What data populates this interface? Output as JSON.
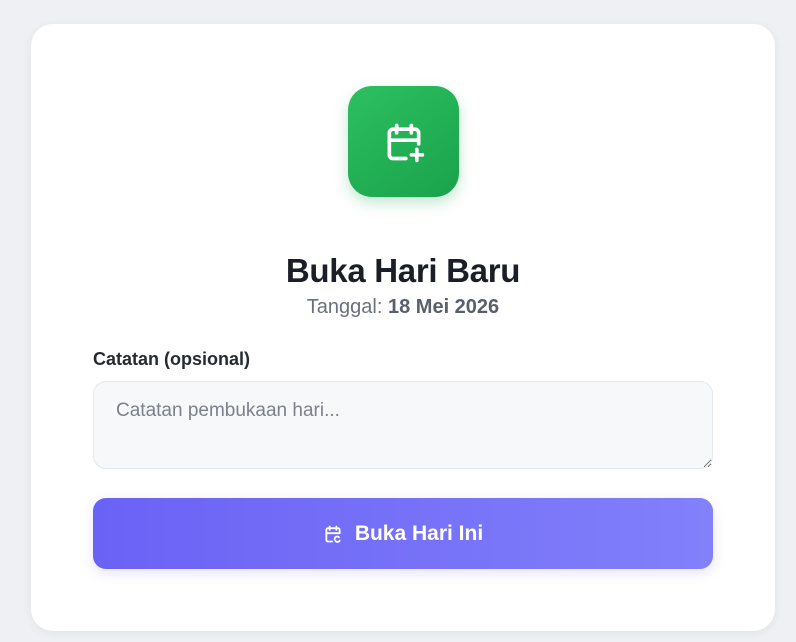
{
  "dialog": {
    "icon": "calendar-plus-icon",
    "title": "Buka Hari Baru",
    "date_label": "Tanggal:",
    "date_value": "18 Mei 2026"
  },
  "notes_field": {
    "label": "Catatan (opsional)",
    "value": "",
    "placeholder": "Catatan pembukaan hari..."
  },
  "open_button": {
    "icon": "calendar-refresh-icon",
    "label": "Buka Hari Ini"
  },
  "colors": {
    "icon_tile_green": "#1fb053",
    "button_start": "#6a62f5",
    "button_end": "#8280fb",
    "title_text": "#1b1e26",
    "page_background": "#eef0f3"
  }
}
